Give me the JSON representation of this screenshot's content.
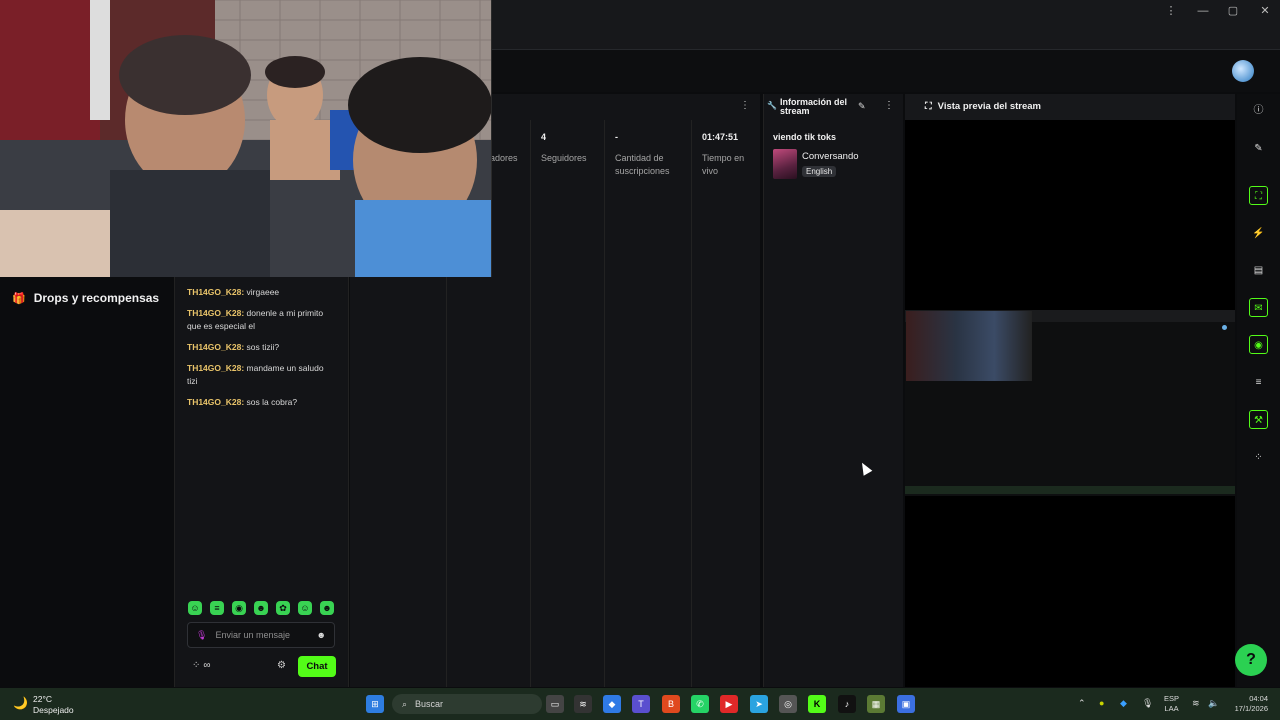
{
  "window": {
    "menu_icon": "⋮",
    "minimize": "—",
    "maximize": "▢",
    "close": "✕"
  },
  "sidebar": {
    "drops_label": "Drops y recompensas"
  },
  "chat": {
    "messages": [
      {
        "user": "TH14GO_K28:",
        "text": "virgaeee"
      },
      {
        "user": "TH14GO_K28:",
        "text": "donenle a mi primito que es especial el"
      },
      {
        "user": "TH14GO_K28:",
        "text": "sos tizii?"
      },
      {
        "user": "TH14GO_K28:",
        "text": "mandame un saludo tizi"
      },
      {
        "user": "TH14GO_K28:",
        "text": "sos la cobra?"
      }
    ],
    "input_placeholder": "Enviar un mensaje",
    "infinity_label": "∞",
    "send_button": "Chat"
  },
  "stats": {
    "partial_label": "adores",
    "followers_value": "4",
    "followers_label": "Seguidores",
    "subs_value": "-",
    "subs_label": "Cantidad de suscripciones",
    "live_value": "01:47:51",
    "live_label": "Tiempo en vivo"
  },
  "info": {
    "title": "Información del stream",
    "stream_title": "viendo tik toks",
    "category": "Conversando",
    "language": "English"
  },
  "preview": {
    "title": "Vista previa del stream"
  },
  "taskbar": {
    "temp": "22°C",
    "weather": "Despejado",
    "search_placeholder": "Buscar",
    "lang": "ESP",
    "region": "LAA",
    "time": "04:04",
    "date": "17/1/2026"
  },
  "colors": {
    "accent": "#53fc18",
    "username": "#e9c46a"
  }
}
